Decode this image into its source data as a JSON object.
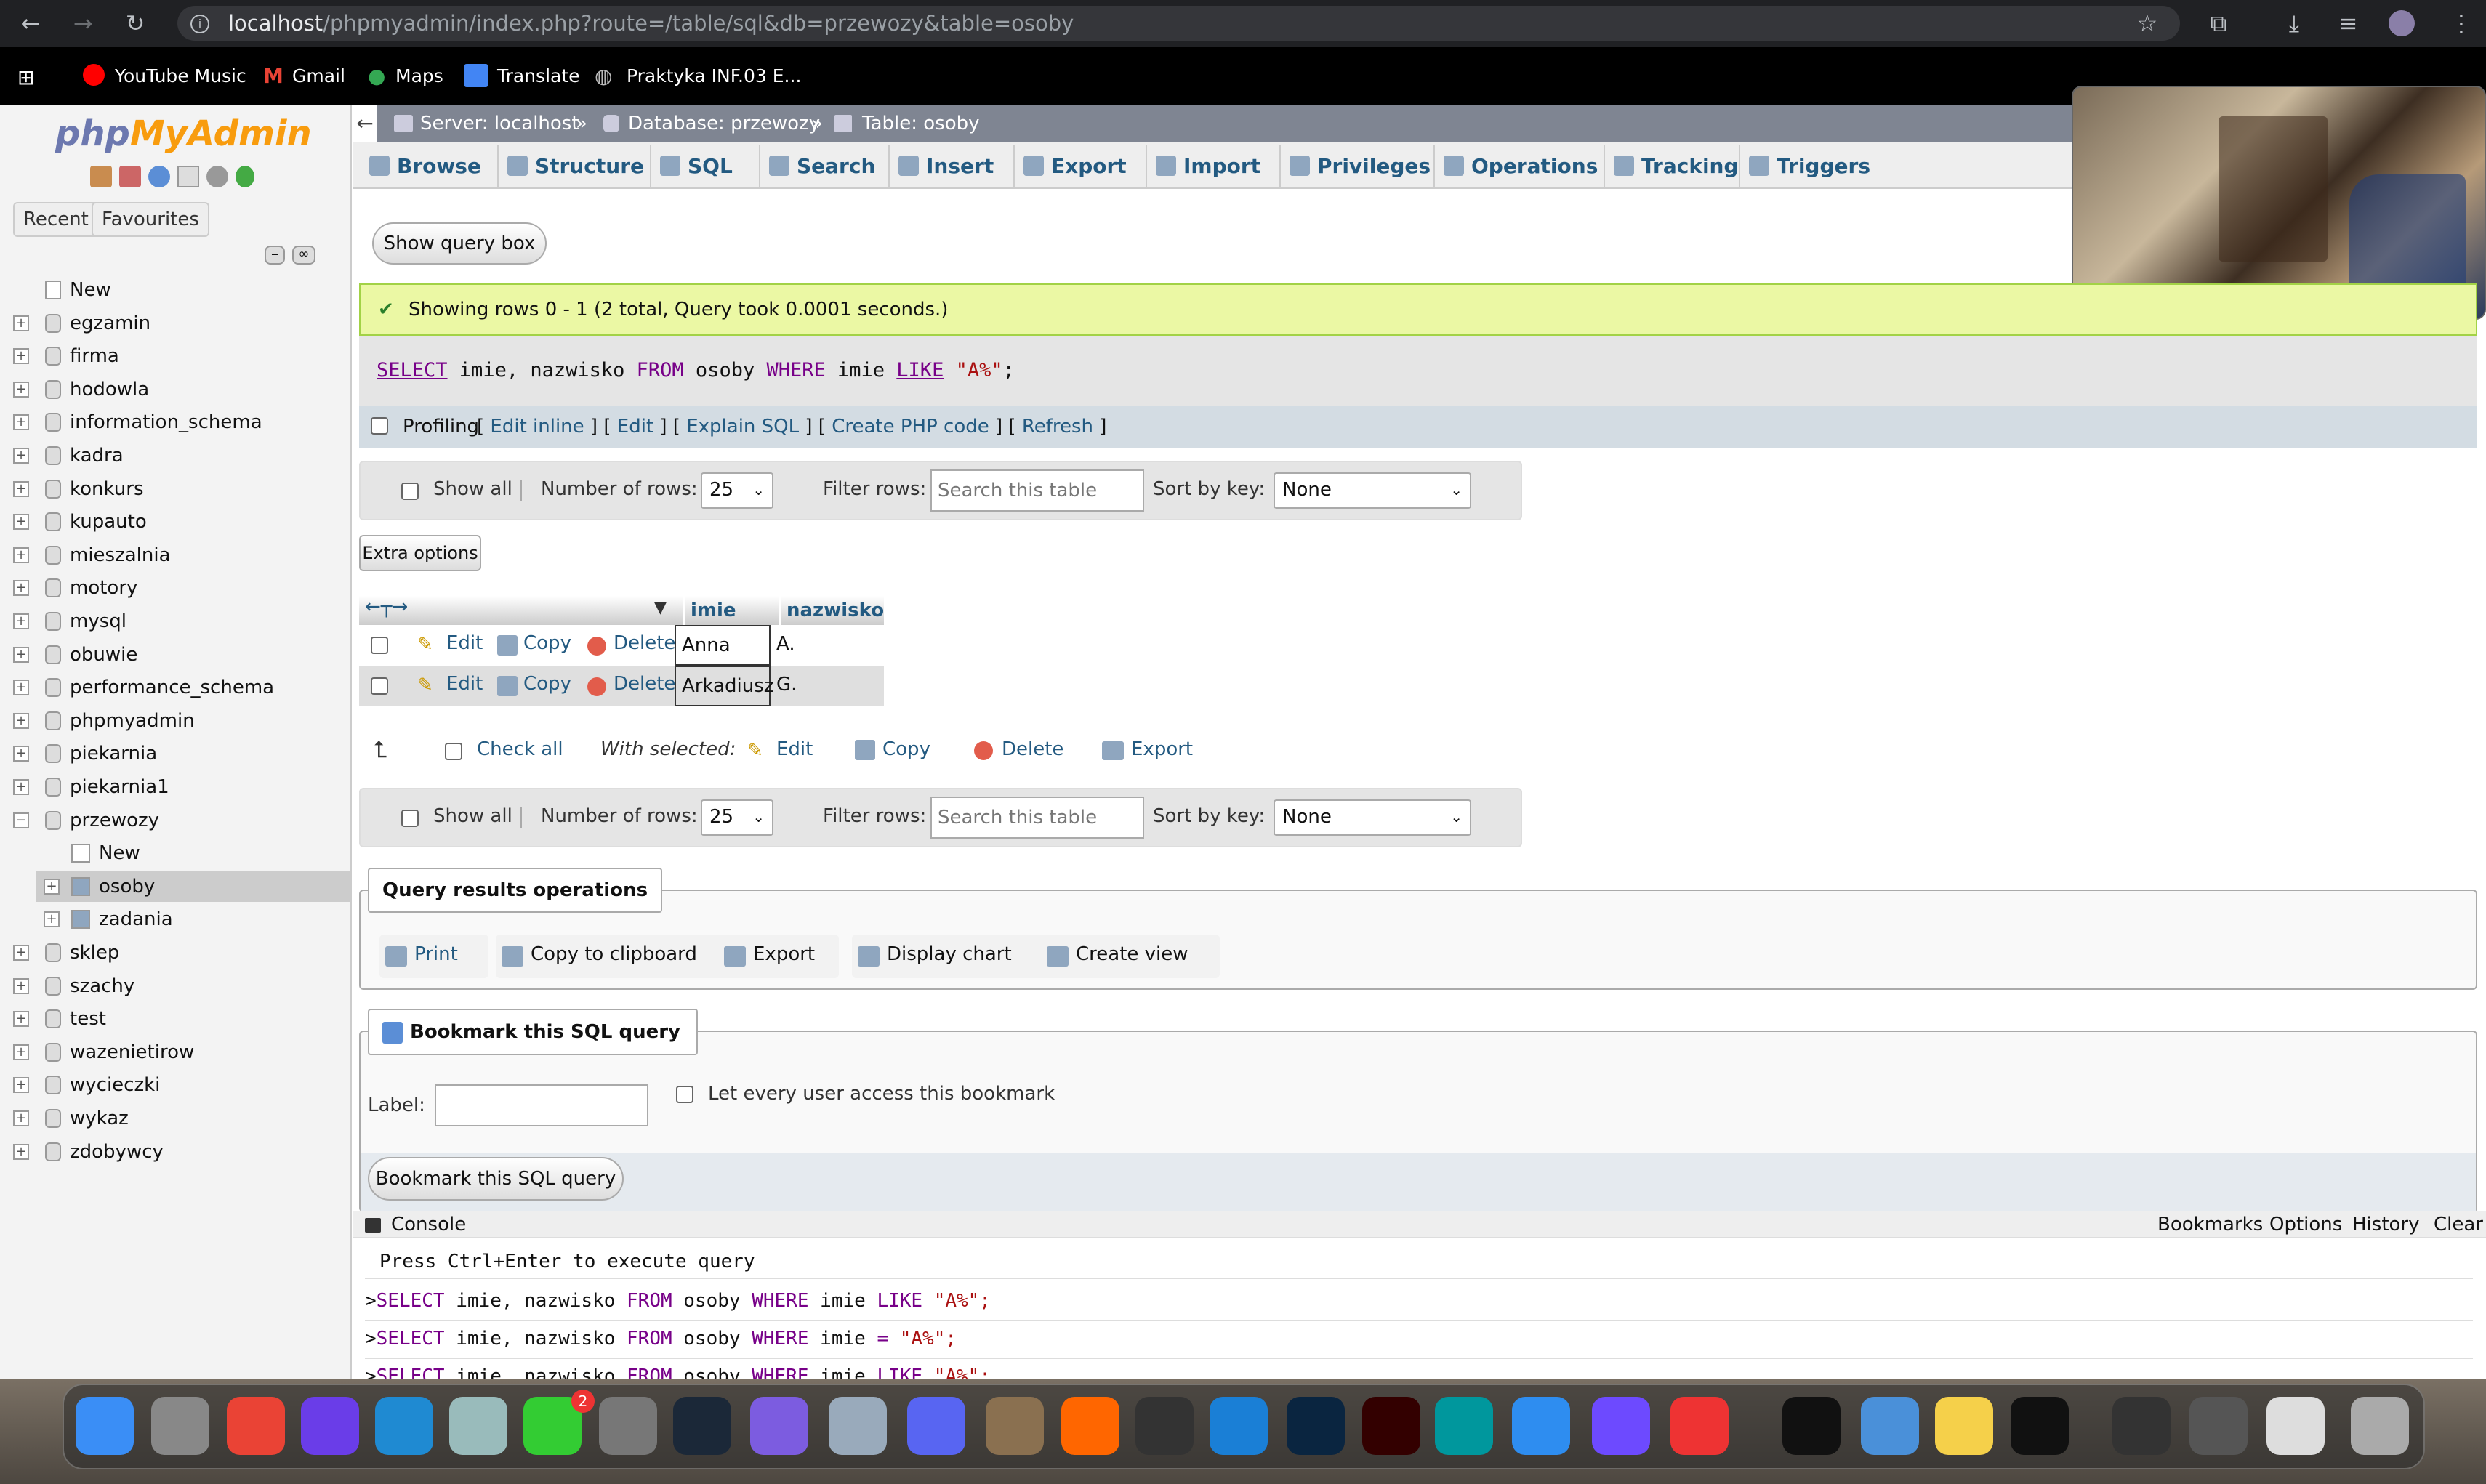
{
  "browser": {
    "url_host": "localhost",
    "url_path": "/phpmyadmin/index.php?route=/table/sql&db=przewozy&table=osoby",
    "bookmarks": [
      "YouTube Music",
      "Gmail",
      "Maps",
      "Translate",
      "Praktyka INF.03 E..."
    ]
  },
  "pma": {
    "logo_a": "php",
    "logo_b": "MyAdmin",
    "nav_tabs": [
      "Recent",
      "Favourites"
    ],
    "tree": [
      "New",
      "egzamin",
      "firma",
      "hodowla",
      "information_schema",
      "kadra",
      "konkurs",
      "kupauto",
      "mieszalnia",
      "motory",
      "mysql",
      "obuwie",
      "performance_schema",
      "phpmyadmin",
      "piekarnia",
      "piekarnia1",
      "przewozy",
      "sklep",
      "szachy",
      "test",
      "wazenietirow",
      "wycieczki",
      "wykaz",
      "zdobywcy"
    ],
    "przewozy_children": [
      "New",
      "osoby",
      "zadania"
    ]
  },
  "breadcrumb": {
    "server": "Server: localhost",
    "database": "Database: przewozy",
    "table": "Table: osoby",
    "sep": "»"
  },
  "tabs": [
    "Browse",
    "Structure",
    "SQL",
    "Search",
    "Insert",
    "Export",
    "Import",
    "Privileges",
    "Operations",
    "Tracking",
    "Triggers"
  ],
  "query": {
    "show_box": "Show query box",
    "success": "Showing rows 0 - 1 (2 total, Query took 0.0001 seconds.)",
    "sql_kw1": "SELECT",
    "sql_mid": " imie, nazwisko ",
    "sql_kw2": "FROM",
    "sql_mid2": " osoby ",
    "sql_kw3": "WHERE",
    "sql_mid3": " imie ",
    "sql_kw4": "LIKE",
    "sql_str": " \"A%\"",
    "sql_end": ";"
  },
  "profiling": {
    "label": "Profiling",
    "links": [
      "Edit inline",
      "Edit",
      "Explain SQL",
      "Create PHP code",
      "Refresh"
    ]
  },
  "navbar": {
    "show_all": "Show all",
    "num_rows_label": "Number of rows:",
    "num_rows": "25",
    "filter_label": "Filter rows:",
    "filter_placeholder": "Search this table",
    "sort_label": "Sort by key:",
    "sort_value": "None"
  },
  "extra_options": "Extra options",
  "results": {
    "columns": [
      "imie",
      "nazwisko"
    ],
    "rows": [
      [
        "Anna",
        "A."
      ],
      [
        "Arkadiusz",
        "G."
      ]
    ],
    "actions": [
      "Edit",
      "Copy",
      "Delete"
    ]
  },
  "with_selected": {
    "check_all": "Check all",
    "label": "With selected:",
    "actions": [
      "Edit",
      "Copy",
      "Delete",
      "Export"
    ]
  },
  "qro": {
    "title": "Query results operations",
    "items": [
      "Print",
      "Copy to clipboard",
      "Export",
      "Display chart",
      "Create view"
    ]
  },
  "bookmark": {
    "title": "Bookmark this SQL query",
    "label": "Label:",
    "share": "Let every user access this bookmark",
    "button": "Bookmark this SQL query"
  },
  "console": {
    "title": "Console",
    "links": [
      "Bookmarks",
      "Options",
      "History",
      "Clear"
    ],
    "hint": "Press Ctrl+Enter to execute query",
    "lines": [
      {
        "kw": "SELECT",
        "a": " imie, nazwisko ",
        "kw2": "FROM",
        "b": " osoby ",
        "kw3": "WHERE",
        "c": " imie ",
        "kw4": "LIKE",
        "d": " \"A%\";"
      },
      {
        "kw": "SELECT",
        "a": " imie, nazwisko ",
        "kw2": "FROM",
        "b": " osoby ",
        "kw3": "WHERE",
        "c": " imie ",
        "kw4": "=",
        "d": " \"A%\";"
      },
      {
        "kw": "SELECT",
        "a": " imie, nazwisko ",
        "kw2": "FROM",
        "b": " osoby ",
        "kw3": "WHERE",
        "c": " imie ",
        "kw4": "LIKE",
        "d": " \"A%\";"
      }
    ]
  },
  "dock": {
    "messages_badge": "2"
  }
}
